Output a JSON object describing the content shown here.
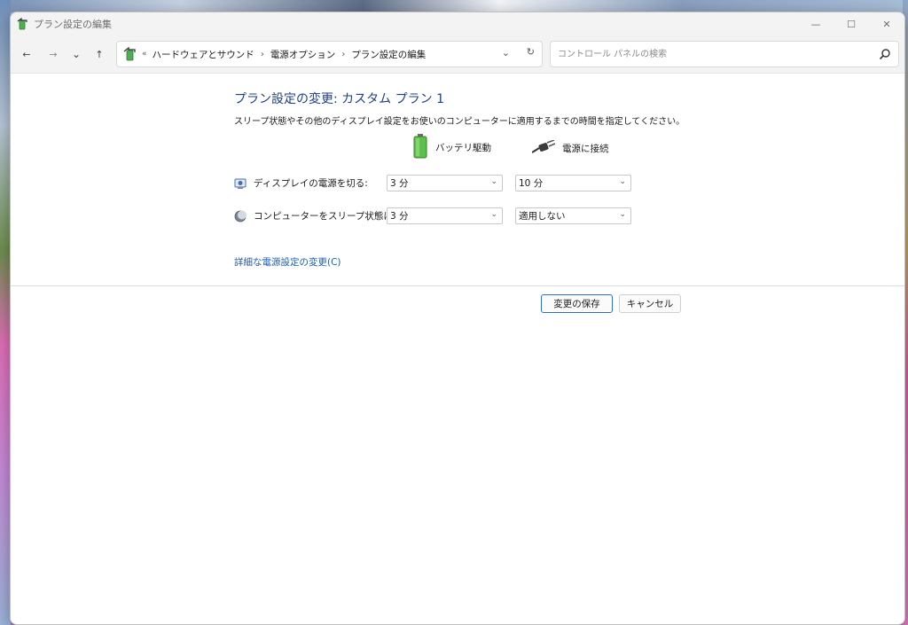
{
  "window": {
    "title": "プラン設定の編集",
    "controls": {
      "minimize": "—",
      "maximize": "☐",
      "close": "✕"
    }
  },
  "nav": {
    "back": "←",
    "forward": "→",
    "recent": "⌄",
    "up": "↑"
  },
  "address": {
    "more": "«",
    "crumbs": [
      "ハードウェアとサウンド",
      "電源オプション",
      "プラン設定の編集"
    ],
    "separator": "›",
    "dropdown": "⌄",
    "refresh": "↻"
  },
  "search": {
    "placeholder": "コントロール パネルの検索"
  },
  "main": {
    "heading": "プラン設定の変更: カスタム プラン 1",
    "description": "スリープ状態やその他のディスプレイ設定をお使いのコンピューターに適用するまでの時間を指定してください。",
    "columns": {
      "battery": "バッテリ駆動",
      "plugged": "電源に接続"
    },
    "rows": [
      {
        "label": "ディスプレイの電源を切る:",
        "battery_value": "3 分",
        "plugged_value": "10 分"
      },
      {
        "label": "コンピューターをスリープ状態にする:",
        "battery_value": "3 分",
        "plugged_value": "適用しない"
      }
    ],
    "advanced_link": "詳細な電源設定の変更(C)"
  },
  "buttons": {
    "save": "変更の保存",
    "cancel": "キャンセル"
  },
  "colors": {
    "heading": "#1e3f8a",
    "link": "#1b5bb5",
    "primary_border": "#2b6fc9"
  }
}
